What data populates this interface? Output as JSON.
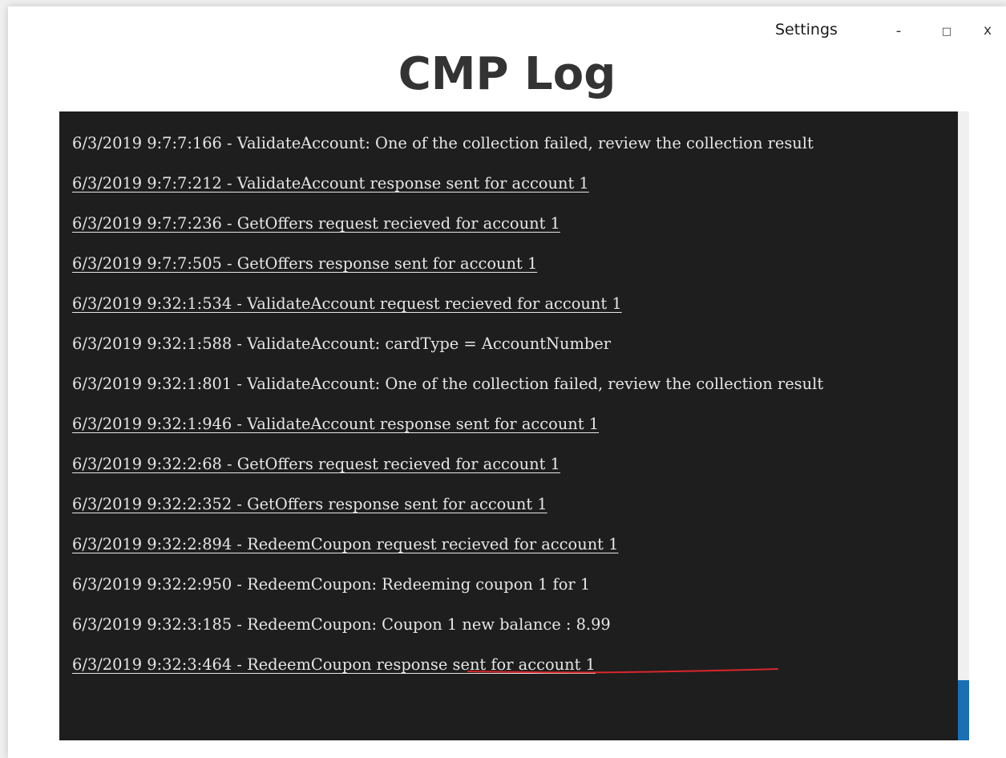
{
  "window": {
    "settings_label": "Settings",
    "minimize_label": "-",
    "maximize_label": "□",
    "close_label": "x"
  },
  "page_title": "CMP Log",
  "log_entries": [
    {
      "text": "6/3/2019 9:7:7:166 - ValidateAccount: One of the collection failed, review the collection result",
      "underlined": false
    },
    {
      "text": "6/3/2019 9:7:7:212 - ValidateAccount response sent for account 1",
      "underlined": true
    },
    {
      "text": "6/3/2019 9:7:7:236 - GetOffers request recieved for account 1",
      "underlined": true
    },
    {
      "text": "6/3/2019 9:7:7:505 - GetOffers response sent for account 1",
      "underlined": true
    },
    {
      "text": "6/3/2019 9:32:1:534 - ValidateAccount request recieved for account 1",
      "underlined": true
    },
    {
      "text": "6/3/2019 9:32:1:588 - ValidateAccount: cardType = AccountNumber",
      "underlined": false
    },
    {
      "text": "6/3/2019 9:32:1:801 - ValidateAccount: One of the collection failed, review the collection result",
      "underlined": false
    },
    {
      "text": "6/3/2019 9:32:1:946 - ValidateAccount response sent for account 1",
      "underlined": true
    },
    {
      "text": "6/3/2019 9:32:2:68 - GetOffers request recieved for account 1",
      "underlined": true
    },
    {
      "text": "6/3/2019 9:32:2:352 - GetOffers response sent for account 1",
      "underlined": true
    },
    {
      "text": "6/3/2019 9:32:2:894 - RedeemCoupon request recieved for account 1",
      "underlined": true
    },
    {
      "text": "6/3/2019 9:32:2:950 - RedeemCoupon: Redeeming coupon 1 for 1",
      "underlined": false
    },
    {
      "text": "6/3/2019 9:32:3:185 - RedeemCoupon: Coupon 1 new balance : 8.99",
      "underlined": false
    },
    {
      "text": "6/3/2019 9:32:3:464 - RedeemCoupon response sent for account 1",
      "underlined": true
    }
  ],
  "colors": {
    "log_background": "#1e1e1e",
    "log_text": "#e6e6e6",
    "scrollbar_thumb": "#1a6fb5",
    "annotation_mark": "#d9262b"
  }
}
